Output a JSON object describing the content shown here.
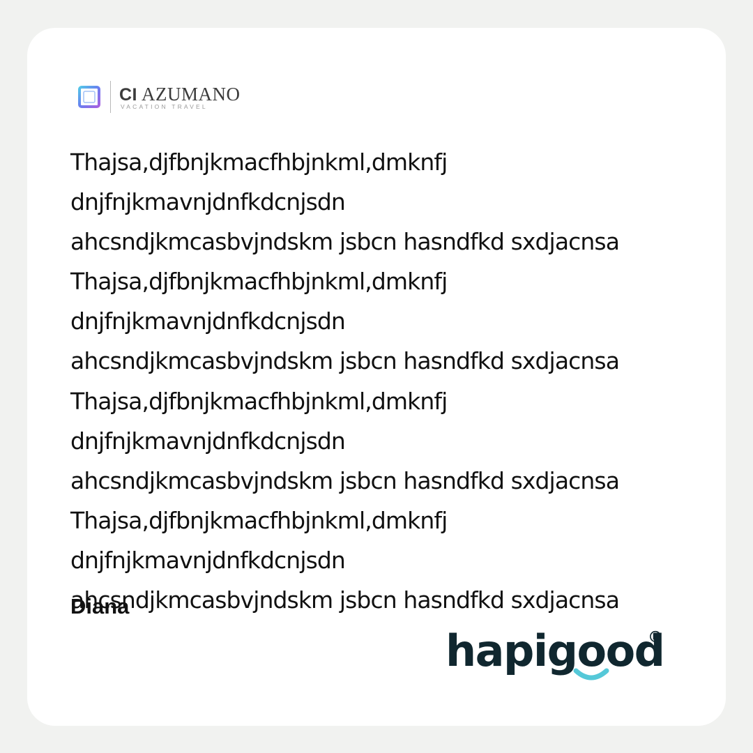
{
  "company": {
    "name_initials": "CI",
    "name": "AZUMANO",
    "tagline": "VACATION TRAVEL",
    "icon": "square-logo-icon"
  },
  "message": {
    "lines": [
      "Thajsa,djfbnjkmacfhbjnkml,dmknfj",
      "dnjfnjkmavnjdnfkdcnjsdn",
      "ahcsndjkmcasbvjndskm jsbcn hasndfkd sxdjacnsa",
      "Thajsa,djfbnjkmacfhbjnkml,dmknfj",
      "dnjfnjkmavnjdnfkdcnjsdn",
      "ahcsndjkmcasbvjndskm jsbcn hasndfkd sxdjacnsa",
      "Thajsa,djfbnjkmacfhbjnkml,dmknfj",
      "dnjfnjkmavnjdnfkdcnjsdn",
      "ahcsndjkmcasbvjndskm jsbcn hasndfkd sxdjacnsa",
      "Thajsa,djfbnjkmacfhbjnkml,dmknfj",
      "dnjfnjkmavnjdnfkdcnjsdn",
      "ahcsndjkmcasbvjndskm jsbcn hasndfkd sxdjacnsa"
    ]
  },
  "signature": {
    "name": "Diana"
  },
  "brand": {
    "name": "hapigood",
    "registered": "®",
    "icon": "smile-icon",
    "colors": {
      "text": "#10272f",
      "accent": "#55c8d8"
    }
  },
  "colors": {
    "background": "#f1f2f0",
    "card": "#ffffff",
    "text": "#111111"
  }
}
